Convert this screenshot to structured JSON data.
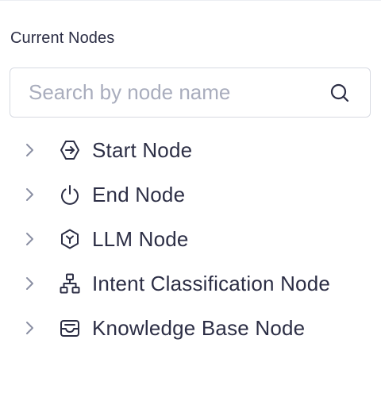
{
  "panel": {
    "title": "Current Nodes"
  },
  "search": {
    "placeholder": "Search by node name",
    "value": "",
    "icon": "search-icon"
  },
  "nodes": [
    {
      "label": "Start Node",
      "icon": "start-node-icon",
      "expanded": false
    },
    {
      "label": "End Node",
      "icon": "power-icon",
      "expanded": false
    },
    {
      "label": "LLM Node",
      "icon": "llm-hexagon-icon",
      "expanded": false
    },
    {
      "label": "Intent Classification Node",
      "icon": "hierarchy-icon",
      "expanded": false
    },
    {
      "label": "Knowledge Base Node",
      "icon": "inbox-icon",
      "expanded": false
    }
  ],
  "colors": {
    "text": "#2c2e45",
    "icon": "#2c2e45",
    "chevron": "#8a8fa3",
    "placeholder": "#a9adbd",
    "border": "#d7dae2"
  }
}
